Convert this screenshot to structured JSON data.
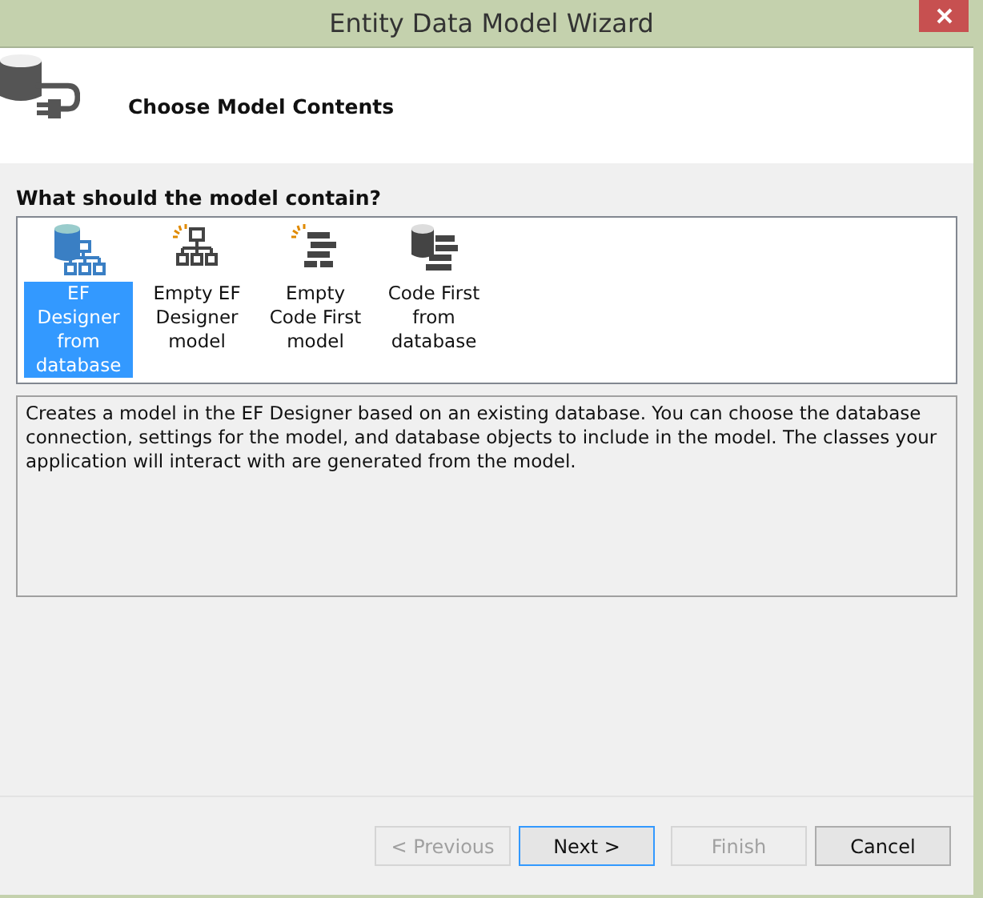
{
  "window": {
    "title": "Entity Data Model Wizard"
  },
  "header": {
    "title": "Choose Model Contents"
  },
  "question": "What should the model contain?",
  "options": [
    {
      "kind": "designer-db",
      "label": "EF Designer from database",
      "selected": true
    },
    {
      "kind": "designer-empty",
      "label": "Empty EF Designer model",
      "selected": false
    },
    {
      "kind": "code-empty",
      "label": "Empty Code First model",
      "selected": false
    },
    {
      "kind": "code-db",
      "label": "Code First from database",
      "selected": false
    }
  ],
  "description": "Creates a model in the EF Designer based on an existing database. You can choose the database connection, settings for the model, and database objects to include in the model. The classes your application will interact with are generated from the model.",
  "buttons": [
    {
      "label": "< Previous",
      "disabled": true,
      "default": false
    },
    {
      "label": "Next >",
      "disabled": false,
      "default": true
    },
    {
      "label": "Finish",
      "disabled": true,
      "default": false
    },
    {
      "label": "Cancel",
      "disabled": false,
      "default": false
    }
  ]
}
